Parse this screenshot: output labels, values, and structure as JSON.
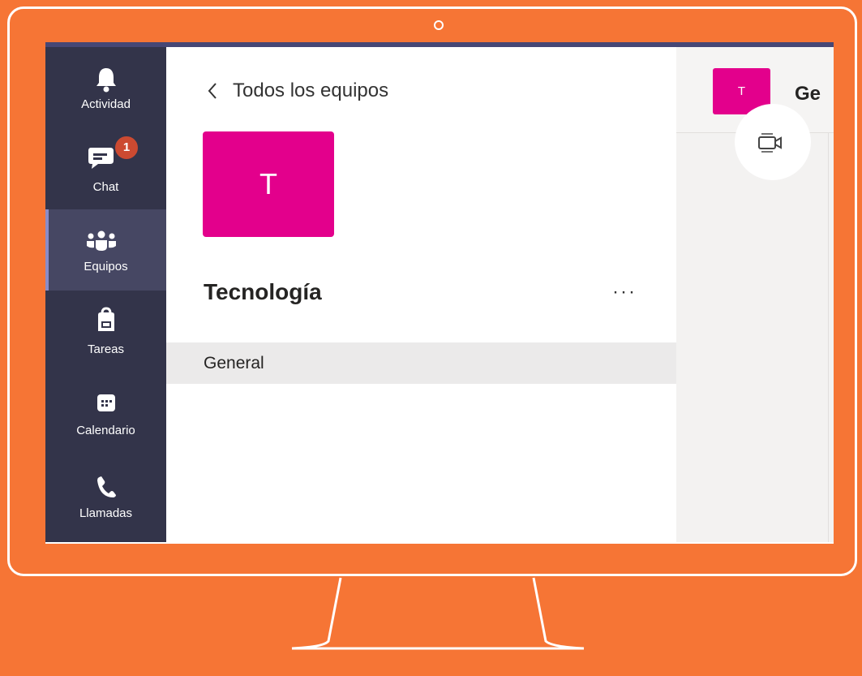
{
  "rail": {
    "items": [
      {
        "label": "Actividad"
      },
      {
        "label": "Chat",
        "badge": "1"
      },
      {
        "label": "Equipos"
      },
      {
        "label": "Tareas"
      },
      {
        "label": "Calendario"
      },
      {
        "label": "Llamadas"
      }
    ]
  },
  "panel": {
    "back_label": "Todos los equipos",
    "team_initial": "T",
    "team_name": "Tecnología",
    "more_label": "···",
    "channels": [
      {
        "label": "General"
      }
    ]
  },
  "channel_view": {
    "tile_initial": "T",
    "title": "Ge"
  },
  "colors": {
    "background": "#f67535",
    "rail": "#33344a",
    "team_tile": "#e3008c",
    "badge": "#cc4a31"
  },
  "icons": {
    "rail": [
      "bell-icon",
      "chat-icon",
      "teams-icon",
      "assignments-icon",
      "calendar-icon",
      "phone-icon"
    ],
    "back": "chevron-left-icon",
    "meet": "video-camera-icon"
  }
}
